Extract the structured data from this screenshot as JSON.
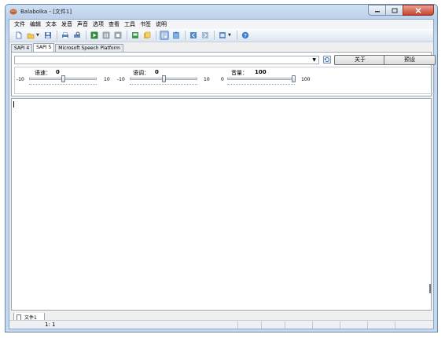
{
  "window": {
    "title": "Balabolka - [文件1]"
  },
  "menu": [
    "文件",
    "编辑",
    "文本",
    "发音",
    "声音",
    "选项",
    "查看",
    "工具",
    "书签",
    "说明"
  ],
  "toolbar": {
    "buttons": [
      "new-document-icon",
      "open-folder-icon",
      "save-icon",
      "print-icon",
      "print-preview-icon",
      "play-icon",
      "pause-icon",
      "stop-icon",
      "save-audio-icon",
      "convert-icon",
      "selection-mode-icon",
      "clipboard-watch-icon",
      "back-icon",
      "forward-icon",
      "settings-dropdown-icon",
      "help-icon"
    ]
  },
  "tabs": [
    "SAPI 4",
    "SAPI 5",
    "Microsoft Speech Platform"
  ],
  "active_tab": "SAPI 5",
  "voice_panel": {
    "about_label": "关于",
    "defaults_label": "预设",
    "rate": {
      "label": "语速：",
      "value": "0",
      "min": "-10",
      "max": "10",
      "level": 0.5
    },
    "pitch": {
      "label": "语调：",
      "value": "0",
      "min": "-10",
      "max": "10",
      "level": 0.5
    },
    "volume": {
      "label": "音量：",
      "value": "100",
      "min": "0",
      "max": "100",
      "level": 1.0
    }
  },
  "document_tab": "文件1",
  "status": {
    "position": "1:  1"
  }
}
